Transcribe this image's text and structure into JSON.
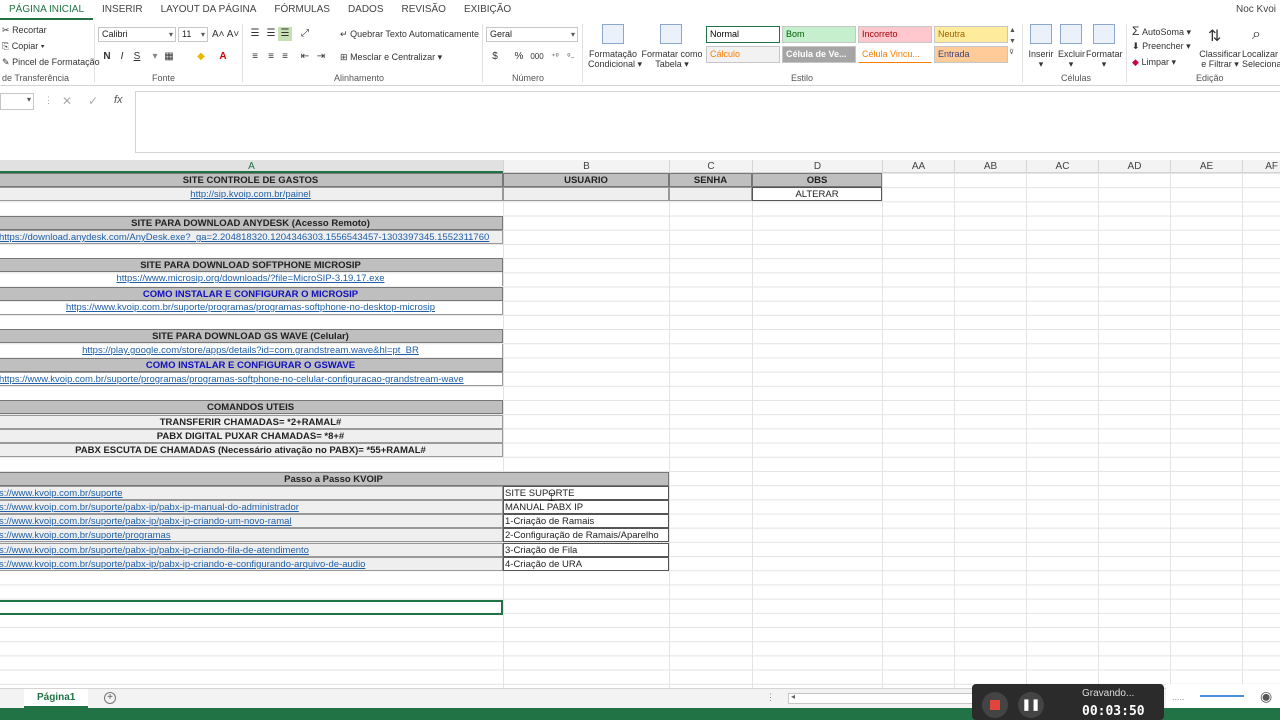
{
  "ribbon_tabs": [
    "PÁGINA INICIAL",
    "INSERIR",
    "LAYOUT DA PÁGINA",
    "FÓRMULAS",
    "DADOS",
    "REVISÃO",
    "EXIBIÇÃO"
  ],
  "user": "Noc Kvoi",
  "clipboard": {
    "cut": "Recortar",
    "copy": "Copiar",
    "painter": "Pincel de Formatação",
    "label": "de Transferência"
  },
  "font": {
    "name": "Calibri",
    "size": "11",
    "label": "Fonte",
    "bold": "N",
    "italic": "I",
    "underline": "S"
  },
  "alignment": {
    "wrap": "Quebrar Texto Automaticamente",
    "merge": "Mesclar e Centralizar",
    "label": "Alinhamento"
  },
  "number": {
    "format": "Geral",
    "label": "Número",
    "percent": "%",
    "thousands": "000"
  },
  "styles_group": {
    "cond": "Formatação",
    "cond2": "Condicional",
    "table": "Formatar como",
    "table2": "Tabela",
    "label": "Estilo",
    "cells": [
      {
        "text": "Normal",
        "bg": "#ffffff",
        "fg": "#000000"
      },
      {
        "text": "Bom",
        "bg": "#c6efce",
        "fg": "#006100"
      },
      {
        "text": "Incorreto",
        "bg": "#ffc7ce",
        "fg": "#9c0006"
      },
      {
        "text": "Neutra",
        "bg": "#ffeb9c",
        "fg": "#9c6500"
      },
      {
        "text": "Cálculo",
        "bg": "#f2f2f2",
        "fg": "#fa7d00"
      },
      {
        "text": "Célula de Ve...",
        "bg": "#a5a5a5",
        "fg": "#ffffff"
      },
      {
        "text": "Célula Vincu...",
        "bg": "#ffffff",
        "fg": "#fa7d00"
      },
      {
        "text": "Entrada",
        "bg": "#ffcc99",
        "fg": "#3f3f76"
      }
    ]
  },
  "cells_group": {
    "insert": "Inserir",
    "delete": "Excluir",
    "format": "Formatar",
    "label": "Células"
  },
  "editing": {
    "autosum": "AutoSoma",
    "fill": "Preencher",
    "clear": "Limpar",
    "sort": "Classificar",
    "sort2": "e Filtrar",
    "find": "Localizar",
    "find2": "Selecionar",
    "label": "Edição"
  },
  "formula_bar": {
    "fx": "fx"
  },
  "columns": [
    "A",
    "B",
    "C",
    "D",
    "AA",
    "AB",
    "AC",
    "AD",
    "AE",
    "AF"
  ],
  "sheet": {
    "r1": {
      "a": "SITE CONTROLE DE GASTOS",
      "b": "USUARIO",
      "c": "SENHA",
      "d": "OBS"
    },
    "r2": {
      "a": "http://sip.kvoip.com.br/painel",
      "d": "ALTERAR"
    },
    "anydesk_title": "SITE PARA DOWNLOAD ANYDESK (Acesso Remoto)",
    "anydesk_link": "https://download.anydesk.com/AnyDesk.exe?_ga=2.204818320.1204346303.1556543457-1303397345.1552311760",
    "microsip_title": "SITE PARA DOWNLOAD SOFTPHONE MICROSIP",
    "microsip_link": "https://www.microsip.org/downloads/?file=MicroSIP-3.19.17.exe",
    "microsip_howto": "COMO INSTALAR E CONFIGURAR O MICROSIP",
    "microsip_howto_link": "https://www.kvoip.com.br/suporte/programas/programas-softphone-no-desktop-microsip",
    "gswave_title": "SITE PARA DOWNLOAD GS WAVE (Celular)",
    "gswave_link": "https://play.google.com/store/apps/details?id=com.grandstream.wave&hl=pt_BR",
    "gswave_howto": "COMO INSTALAR E CONFIGURAR O GSWAVE",
    "gswave_howto_link": "https://www.kvoip.com.br/suporte/programas/programas-softphone-no-celular-configuracao-grandstream-wave",
    "cmd_title": "COMANDOS UTEIS",
    "cmds": [
      "TRANSFERIR CHAMADAS= *2+RAMAL#",
      "PABX DIGITAL PUXAR CHAMADAS= *8+#",
      "PABX ESCUTA DE CHAMADAS (Necessário ativação no PABX)= *55+RAMAL#"
    ],
    "passo_title": "Passo a Passo KVOIP",
    "passo": [
      {
        "link": "s://www.kvoip.com.br/suporte",
        "desc": "SITE SUPORTE"
      },
      {
        "link": "s://www.kvoip.com.br/suporte/pabx-ip/pabx-ip-manual-do-administrador",
        "desc": "MANUAL PABX IP"
      },
      {
        "link": "s://www.kvoip.com.br/suporte/pabx-ip/pabx-ip-criando-um-novo-ramal",
        "desc": "1-Criação de Ramais"
      },
      {
        "link": "s://www.kvoip.com.br/suporte/programas",
        "desc": "2-Configuração de Ramais/Aparelho"
      },
      {
        "link": "s://www.kvoip.com.br/suporte/pabx-ip/pabx-ip-criando-fila-de-atendimento",
        "desc": "3-Criação de Fila"
      },
      {
        "link": "s://www.kvoip.com.br/suporte/pabx-ip/pabx-ip-criando-e-configurando-arquivo-de-audio",
        "desc": "4-Criação de URA"
      }
    ]
  },
  "sheet_tab": "Página1",
  "recorder": {
    "status": "Gravando...",
    "time": "00:03:50"
  }
}
